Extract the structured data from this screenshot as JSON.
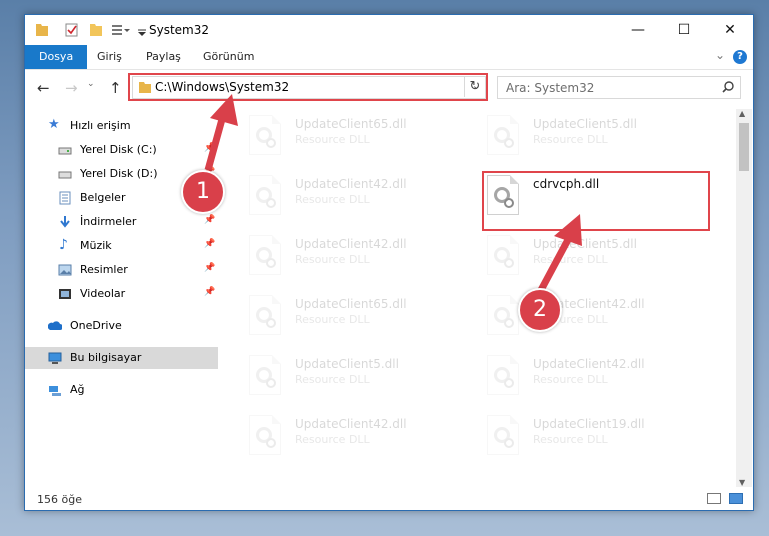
{
  "window": {
    "title": "System32"
  },
  "ribbon": {
    "tabs": [
      {
        "label": "Dosya",
        "active": true
      },
      {
        "label": "Giriş"
      },
      {
        "label": "Paylaş"
      },
      {
        "label": "Görünüm"
      }
    ],
    "help": "?"
  },
  "address": {
    "path": "C:\\Windows\\System32"
  },
  "search": {
    "placeholder": "Ara: System32"
  },
  "nav": {
    "items": [
      {
        "label": "Hızlı erişim",
        "icon": "star-icon"
      },
      {
        "label": "Yerel Disk (C:)",
        "icon": "drive-icon",
        "pinned": true
      },
      {
        "label": "Yerel Disk (D:)",
        "icon": "drive-icon",
        "pinned": true
      },
      {
        "label": "Belgeler",
        "icon": "documents-icon",
        "pinned": true
      },
      {
        "label": "İndirmeler",
        "icon": "download-icon",
        "pinned": true
      },
      {
        "label": "Müzik",
        "icon": "music-icon",
        "pinned": true
      },
      {
        "label": "Resimler",
        "icon": "pictures-icon",
        "pinned": true
      },
      {
        "label": "Videolar",
        "icon": "video-icon",
        "pinned": true
      },
      {
        "label": "OneDrive",
        "icon": "cloud-icon"
      },
      {
        "label": "Bu bilgisayar",
        "icon": "computer-icon",
        "selected": true
      },
      {
        "label": "Ağ",
        "icon": "network-icon"
      }
    ]
  },
  "files": {
    "left": [
      {
        "name": "UpdateClient65.dll",
        "type": "Resource DLL"
      },
      {
        "name": "UpdateClient42.dll",
        "type": "Resource DLL"
      },
      {
        "name": "UpdateClient42.dll",
        "type": "Resource DLL"
      },
      {
        "name": "UpdateClient65.dll",
        "type": "Resource DLL"
      },
      {
        "name": "UpdateClient5.dll",
        "type": "Resource DLL"
      },
      {
        "name": "UpdateClient42.dll",
        "type": "Resource DLL"
      }
    ],
    "right": [
      {
        "name": "UpdateClient5.dll",
        "type": "Resource DLL"
      },
      {
        "name": "cdrvcph.dll",
        "type": "",
        "highlighted": true
      },
      {
        "name": "UpdateClient5.dll",
        "type": "Resource DLL"
      },
      {
        "name": "UpdateClient42.dll",
        "type": "Resource DLL"
      },
      {
        "name": "UpdateClient42.dll",
        "type": "Resource DLL"
      },
      {
        "name": "UpdateClient19.dll",
        "type": "Resource DLL"
      }
    ]
  },
  "status": {
    "count": "156 öğe"
  },
  "annotations": {
    "step1": "1",
    "step2": "2",
    "color": "#d9404a"
  }
}
